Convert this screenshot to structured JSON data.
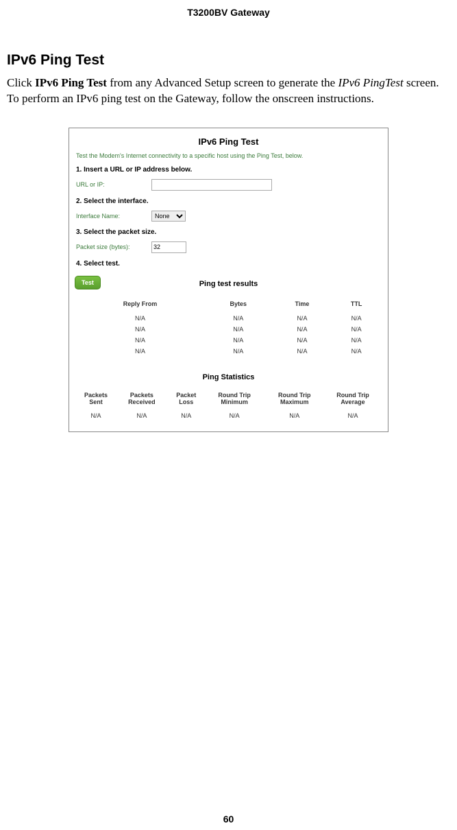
{
  "doc_header": "T3200BV Gateway",
  "section_heading": "IPv6 Ping Test",
  "body": {
    "pre": "Click ",
    "bold": "IPv6 Ping Test",
    "mid": " from any Advanced Setup screen to generate the ",
    "italic": "IPv6 PingTest",
    "post": " screen. To perform an IPv6 ping test on the Gateway, follow the onscreen instructions."
  },
  "page_number": "60",
  "screenshot": {
    "title": "IPv6 Ping Test",
    "intro": "Test the Modem's Internet connectivity to a specific host using the Ping Test, below.",
    "step1": "1. Insert a URL or IP address below.",
    "url_label": "URL or IP:",
    "url_value": "",
    "step2": "2. Select the interface.",
    "iface_label": "Interface Name:",
    "iface_value": "None",
    "step3": "3. Select the packet size.",
    "pkt_label": "Packet size (bytes):",
    "pkt_value": "32",
    "step4": "4. Select test.",
    "test_btn": "Test",
    "results_title": "Ping test results",
    "results_headers": {
      "reply_from": "Reply From",
      "bytes": "Bytes",
      "time": "Time",
      "ttl": "TTL"
    },
    "results_rows": [
      {
        "reply_from": "N/A",
        "bytes": "N/A",
        "time": "N/A",
        "ttl": "N/A"
      },
      {
        "reply_from": "N/A",
        "bytes": "N/A",
        "time": "N/A",
        "ttl": "N/A"
      },
      {
        "reply_from": "N/A",
        "bytes": "N/A",
        "time": "N/A",
        "ttl": "N/A"
      },
      {
        "reply_from": "N/A",
        "bytes": "N/A",
        "time": "N/A",
        "ttl": "N/A"
      }
    ],
    "stats_title": "Ping Statistics",
    "stats_headers": {
      "sent": "Packets Sent",
      "received": "Packets Received",
      "loss": "Packet Loss",
      "rt_min": "Round Trip Minimum",
      "rt_max": "Round Trip Maximum",
      "rt_avg": "Round Trip Average"
    },
    "stats_row": {
      "sent": "N/A",
      "received": "N/A",
      "loss": "N/A",
      "rt_min": "N/A",
      "rt_max": "N/A",
      "rt_avg": "N/A"
    }
  }
}
